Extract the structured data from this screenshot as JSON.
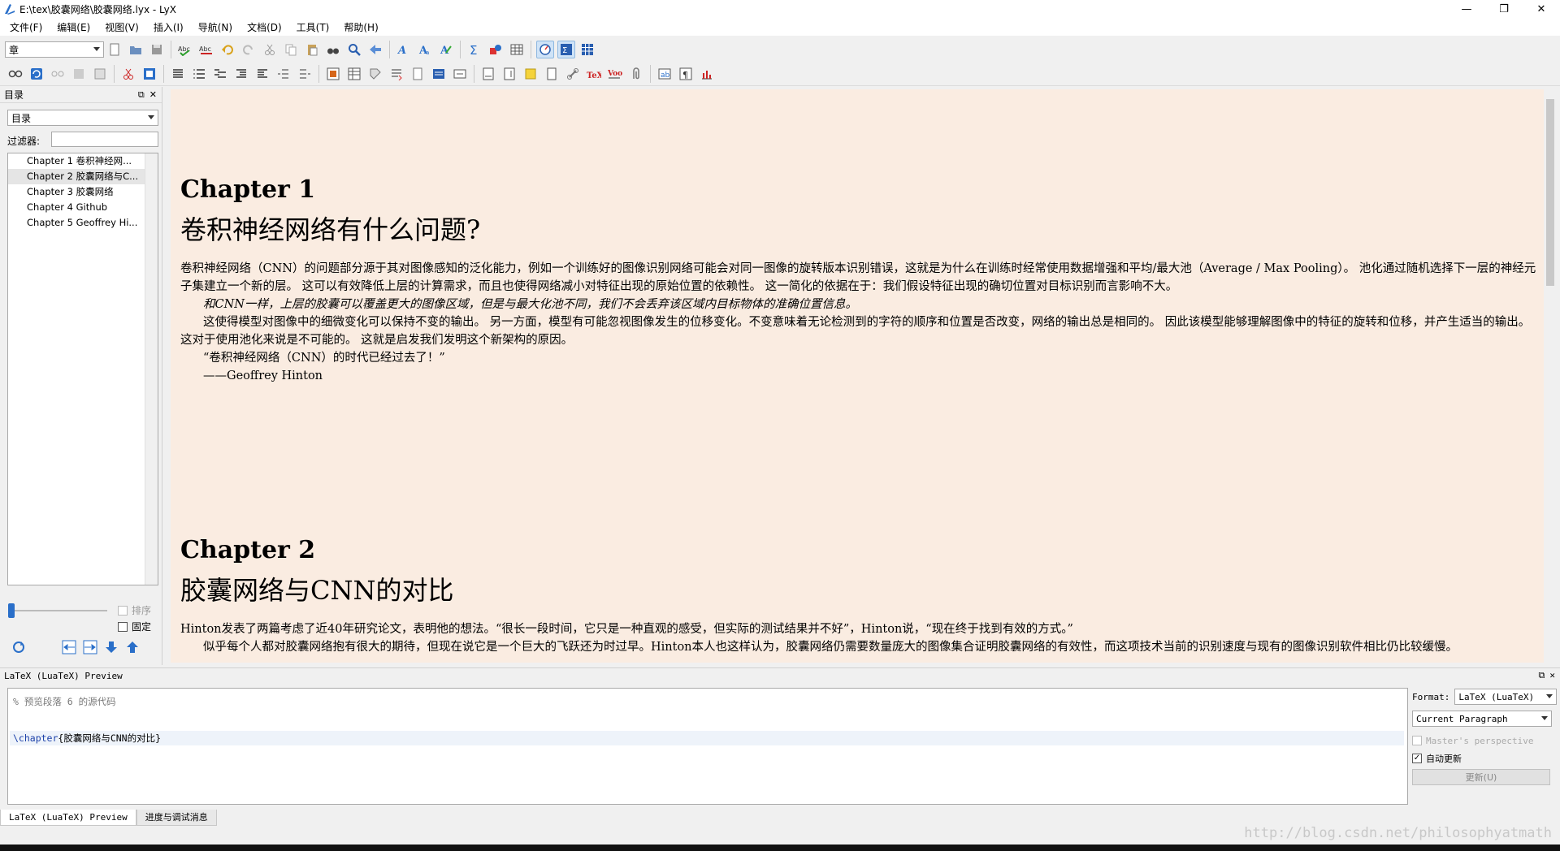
{
  "window": {
    "title": "E:\\tex\\胶囊网络\\胶囊网络.lyx - LyX",
    "minimize": "—",
    "maximize": "❐",
    "close": "✕"
  },
  "menu": [
    "文件(F)",
    "编辑(E)",
    "视图(V)",
    "插入(I)",
    "导航(N)",
    "文档(D)",
    "工具(T)",
    "帮助(H)"
  ],
  "toolbar": {
    "paragraph_style": "章"
  },
  "toc": {
    "title": "目录",
    "type_combo": "目录",
    "filter_label": "过滤器:",
    "filter_value": "",
    "items": [
      "Chapter 1 卷积神经网...",
      "Chapter 2 胶囊网络与C...",
      "Chapter 3 胶囊网络",
      "Chapter 4 Github",
      "Chapter 5 Geoffrey Hi..."
    ],
    "selected_index": 1,
    "sort_label": "排序",
    "keep_label": "固定"
  },
  "document": {
    "ch1_num": "Chapter 1",
    "ch1_title": "卷积神经网络有什么问题?",
    "ch1_p1": "卷积神经网络（CNN）的问题部分源于其对图像感知的泛化能力，例如一个训练好的图像识别网络可能会对同一图像的旋转版本识别错误，这就是为什么在训练时经常使用数据增强和平均/最大池（Average / Max Pooling）。 池化通过随机选择下一层的神经元子集建立一个新的层。 这可以有效降低上层的计算需求，而且也使得网络减小对特征出现的原始位置的依赖性。 这一简化的依据在于：我们假设特征出现的确切位置对目标识别而言影响不大。",
    "ch1_p2": "和CNN一样，上层的胶囊可以覆盖更大的图像区域，但是与最大化池不同，我们不会丢弃该区域内目标物体的准确位置信息。",
    "ch1_p3": "这使得模型对图像中的细微变化可以保持不变的输出。 另一方面，模型有可能忽视图像发生的位移变化。不变意味着无论检测到的字符的顺序和位置是否改变，网络的输出总是相同的。 因此该模型能够理解图像中的特征的旋转和位移，并产生适当的输出。 这对于使用池化来说是不可能的。 这就是启发我们发明这个新架构的原因。",
    "ch1_p4": "“卷积神经网络（CNN）的时代已经过去了！”",
    "ch1_p5": "——Geoffrey Hinton",
    "ch2_num": "Chapter 2",
    "ch2_title": "胶囊网络与CNN的对比",
    "ch2_p1": "Hinton发表了两篇考虑了近40年研究论文，表明他的想法。“很长一段时间，它只是一种直观的感受，但实际的测试结果并不好”，Hinton说，“现在终于找到有效的方式。”",
    "ch2_p2": "似乎每个人都对胶囊网络抱有很大的期待，但现在说它是一个巨大的飞跃还为时过早。Hinton本人也这样认为，胶囊网络仍需要数量庞大的图像集合证明胶囊网络的有效性，而这项技术当前的识别速度与现有的图像识别软件相比仍比较缓慢。"
  },
  "preview": {
    "title": "LaTeX (LuaTeX) Preview",
    "comment": "% 预览段落 6 的源代码",
    "code_cmd": "\\chapter",
    "code_arg": "{胶囊网络与CNN的对比}",
    "format_label": "Format:",
    "format_value": "LaTeX (LuaTeX)",
    "scope_value": "Current Paragraph",
    "masters_label": "Master's perspective",
    "auto_update_label": "自动更新",
    "update_button": "更新(U)",
    "tabs": [
      "LaTeX (LuaTeX) Preview",
      "进度与调试消息"
    ]
  },
  "watermark": "http://blog.csdn.net/philosophyatmath"
}
